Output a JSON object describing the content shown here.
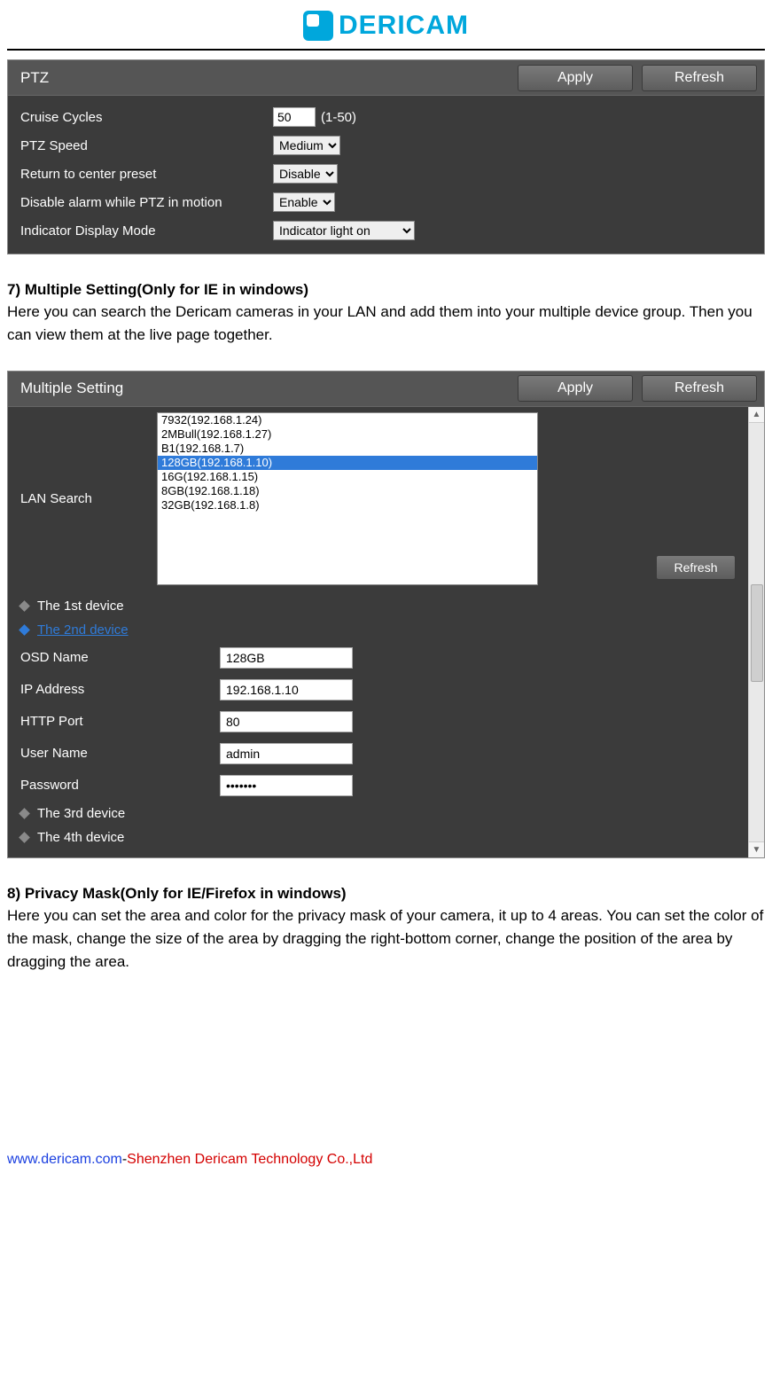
{
  "logo_text": "DERICAM",
  "ptz": {
    "title": "PTZ",
    "apply": "Apply",
    "refresh": "Refresh",
    "rows": {
      "cruise_label": "Cruise Cycles",
      "cruise_value": "50",
      "cruise_suffix": "(1-50)",
      "speed_label": "PTZ Speed",
      "speed_value": "Medium",
      "return_label": "Return to center preset",
      "return_value": "Disable",
      "alarm_label": "Disable alarm while PTZ in motion",
      "alarm_value": "Enable",
      "indicator_label": "Indicator Display Mode",
      "indicator_value": "Indicator light on"
    }
  },
  "section7": {
    "heading": "7) Multiple Setting(Only for IE in windows)",
    "body": "Here you can search the Dericam cameras in your LAN and add them into your multiple device group. Then you can view them at the live page together."
  },
  "ms": {
    "title": "Multiple Setting",
    "apply": "Apply",
    "refresh_top": "Refresh",
    "lan_label": "LAN Search",
    "list": [
      "7932(192.168.1.24)",
      "2MBull(192.168.1.27)",
      "B1(192.168.1.7)",
      "128GB(192.168.1.10)",
      "16G(192.168.1.15)",
      "8GB(192.168.1.18)",
      "32GB(192.168.1.8)"
    ],
    "selected_index": 3,
    "list_refresh": "Refresh",
    "devices": {
      "d1": "The 1st device",
      "d2": "The 2nd device",
      "d3": "The 3rd device",
      "d4": "The 4th device"
    },
    "fields": {
      "osd_label": "OSD Name",
      "osd_value": "128GB",
      "ip_label": "IP Address",
      "ip_value": "192.168.1.10",
      "port_label": "HTTP Port",
      "port_value": "80",
      "user_label": "User Name",
      "user_value": "admin",
      "pass_label": "Password",
      "pass_value": "•••••••"
    }
  },
  "section8": {
    "heading": "8) Privacy Mask(Only for IE/Firefox in windows)",
    "body": "Here you can set the area and color for the privacy mask of your camera, it up to 4 areas. You can set the color of the mask, change the size of the area by dragging the right-bottom corner, change the position of the area by dragging the area."
  },
  "footer": {
    "url": "www.dericam.com",
    "dash": "-",
    "company": "Shenzhen Dericam Technology Co.,Ltd"
  }
}
